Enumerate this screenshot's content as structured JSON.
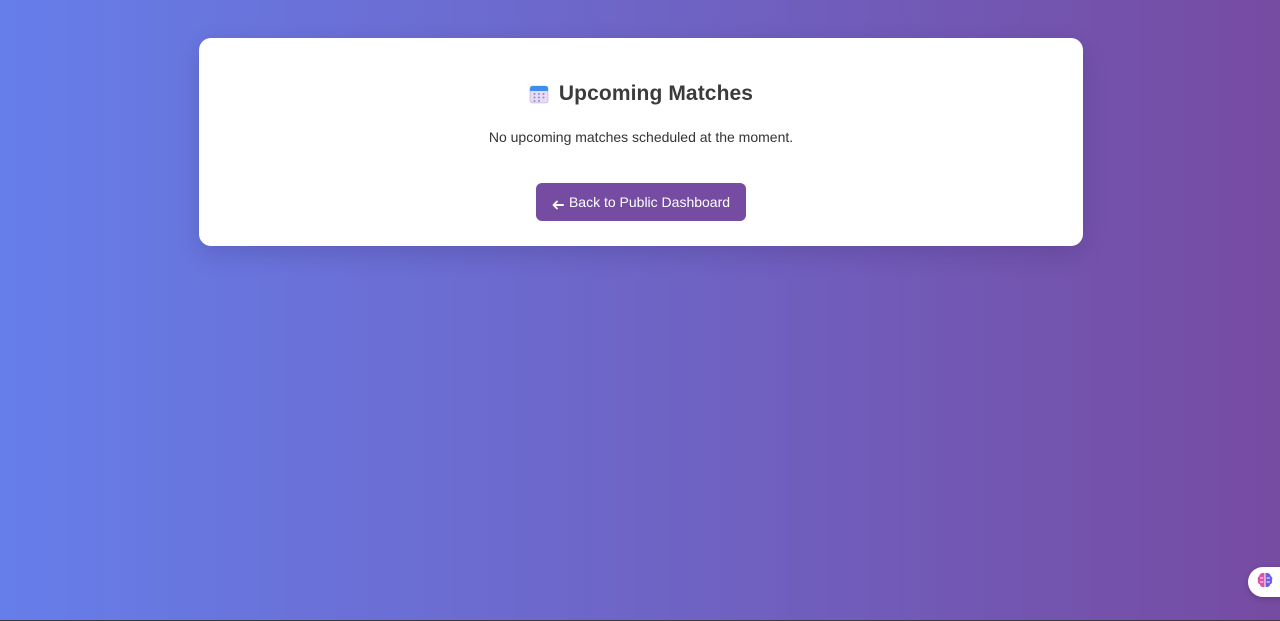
{
  "page": {
    "title": "Upcoming Matches",
    "title_icon": "calendar-icon",
    "empty_message": "No upcoming matches scheduled at the moment.",
    "back_button": {
      "icon": "left-arrow-icon",
      "label": "Back to Public Dashboard"
    }
  },
  "floating_widget": {
    "icon": "brain-icon"
  },
  "colors": {
    "gradient_start": "#667eea",
    "gradient_end": "#764ba2",
    "button": "#764ba2",
    "card": "#ffffff",
    "title_text": "#3b3b3b"
  }
}
